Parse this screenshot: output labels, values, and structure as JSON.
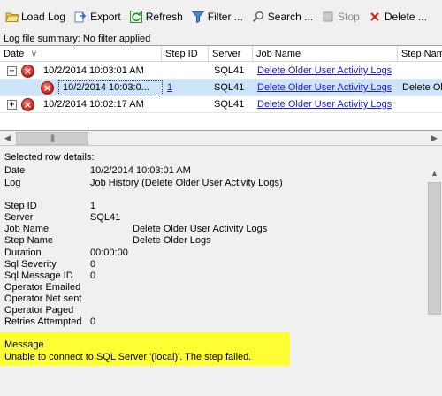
{
  "toolbar": {
    "load_log": "Load Log",
    "export": "Export",
    "refresh": "Refresh",
    "filter": "Filter ...",
    "search": "Search ...",
    "stop": "Stop",
    "delete": "Delete ..."
  },
  "summary": "Log file summary: No filter applied",
  "grid": {
    "columns": [
      "Date",
      "Step ID",
      "Server",
      "Job Name",
      "Step Nam"
    ],
    "rows": [
      {
        "date": "10/2/2014 10:03:01 AM",
        "step_id": "",
        "server": "SQL41",
        "job_name": "Delete Older User Activity Logs",
        "step_name": "",
        "expander": "−"
      },
      {
        "date": "10/2/2014 10:03:0...",
        "step_id": "1",
        "server": "SQL41",
        "job_name": "Delete Older User Activity Logs",
        "step_name": "Delete Ol",
        "expander": ""
      },
      {
        "date": "10/2/2014 10:02:17 AM",
        "step_id": "",
        "server": "SQL41",
        "job_name": "Delete Older User Activity Logs",
        "step_name": "",
        "expander": "+"
      }
    ]
  },
  "details": {
    "title": "Selected row details:",
    "fields": {
      "date_label": "Date",
      "date_value": "10/2/2014 10:03:01 AM",
      "log_label": "Log",
      "log_value": "Job History (Delete Older User Activity Logs)",
      "step_id_label": "Step ID",
      "step_id_value": "1",
      "server_label": "Server",
      "server_value": "SQL41",
      "job_name_label": "Job Name",
      "job_name_value": "Delete Older User Activity Logs",
      "step_name_label": "Step Name",
      "step_name_value": "Delete Older Logs",
      "duration_label": "Duration",
      "duration_value": "00:00:00",
      "sql_severity_label": "Sql Severity",
      "sql_severity_value": "0",
      "sql_message_id_label": "Sql Message ID",
      "sql_message_id_value": "0",
      "operator_emailed_label": "Operator Emailed",
      "operator_net_sent_label": "Operator Net sent",
      "operator_paged_label": "Operator Paged",
      "retries_label": "Retries Attempted",
      "retries_value": "0"
    },
    "message_label": "Message",
    "message_value": "Unable to connect to SQL Server '(local)'.  The step failed."
  },
  "colors": {
    "selected_row": "#cde3f7",
    "link": "#1a1adc",
    "highlight": "#ffff33",
    "error": "#c8201a"
  }
}
